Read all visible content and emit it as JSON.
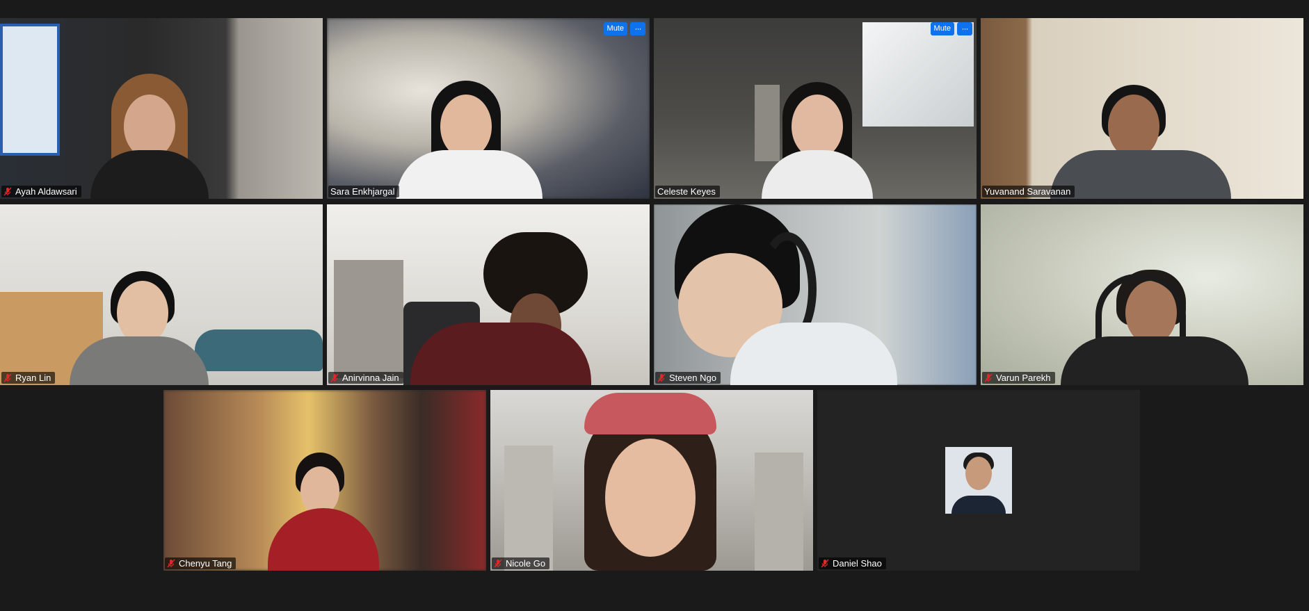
{
  "meeting": {
    "participants": [
      {
        "name": "Ayah Aldawsari",
        "muted": true
      },
      {
        "name": "Sara Enkhjargal",
        "muted": false
      },
      {
        "name": "Celeste Keyes",
        "muted": false
      },
      {
        "name": "Yuvanand Saravanan",
        "muted": false
      },
      {
        "name": "Ryan Lin",
        "muted": true
      },
      {
        "name": "Anirvinna Jain",
        "muted": true
      },
      {
        "name": "Steven Ngo",
        "muted": true
      },
      {
        "name": "Varun Parekh",
        "muted": true
      },
      {
        "name": "Chenyu Tang",
        "muted": true
      },
      {
        "name": "Nicole Go",
        "muted": true
      },
      {
        "name": "Daniel Shao",
        "muted": true
      }
    ],
    "tile_controls": {
      "mute_label": "Mute",
      "more_label": "···"
    },
    "active_speaker_border_color": "#d6e97a",
    "button_color": "#0e72ed",
    "muted_icon_color": "#e02828"
  }
}
